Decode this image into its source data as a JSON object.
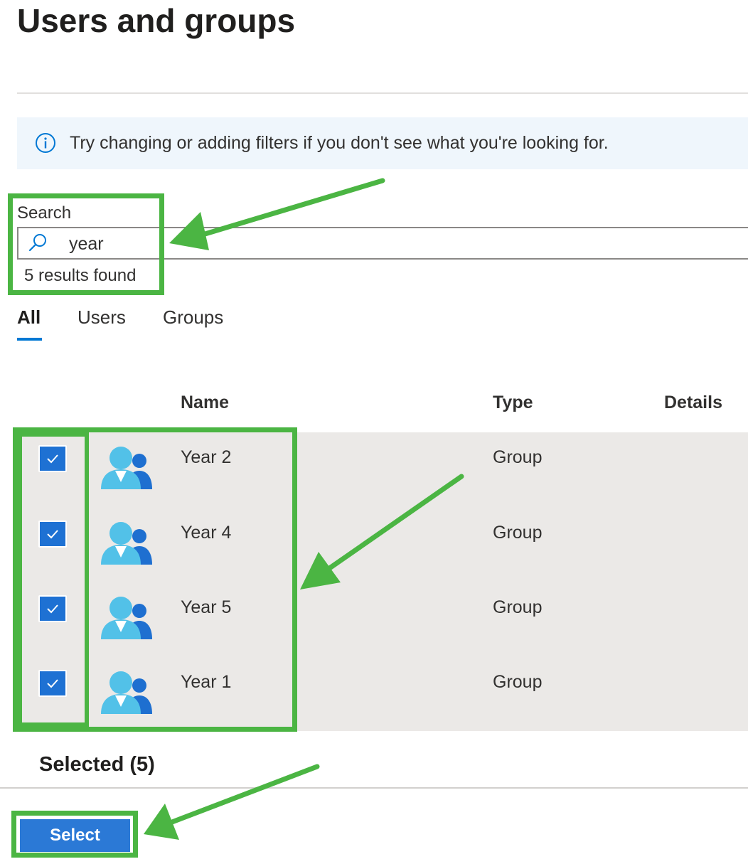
{
  "page": {
    "title": "Users and groups"
  },
  "info_banner": {
    "icon": "info-icon",
    "text": "Try changing or adding filters if you don't see what you're looking for."
  },
  "search": {
    "label": "Search",
    "value": "year",
    "icon": "search-icon",
    "results_text": "5 results found"
  },
  "tabs": [
    {
      "label": "All",
      "active": true
    },
    {
      "label": "Users",
      "active": false
    },
    {
      "label": "Groups",
      "active": false
    }
  ],
  "table": {
    "columns": [
      "Name",
      "Type",
      "Details"
    ],
    "rows": [
      {
        "name": "Year 2",
        "type": "Group",
        "checked": true,
        "icon": "group-icon"
      },
      {
        "name": "Year 4",
        "type": "Group",
        "checked": true,
        "icon": "group-icon"
      },
      {
        "name": "Year 5",
        "type": "Group",
        "checked": true,
        "icon": "group-icon"
      },
      {
        "name": "Year 1",
        "type": "Group",
        "checked": true,
        "icon": "group-icon"
      }
    ]
  },
  "selection": {
    "summary": "Selected (5)"
  },
  "footer": {
    "select_label": "Select"
  },
  "colors": {
    "accent": "#0078d4",
    "checkbox": "#1e71d3",
    "select_button": "#2b79d6",
    "annotation": "#4bb543",
    "row_background": "#ebe9e7",
    "info_background": "#eff6fc"
  }
}
